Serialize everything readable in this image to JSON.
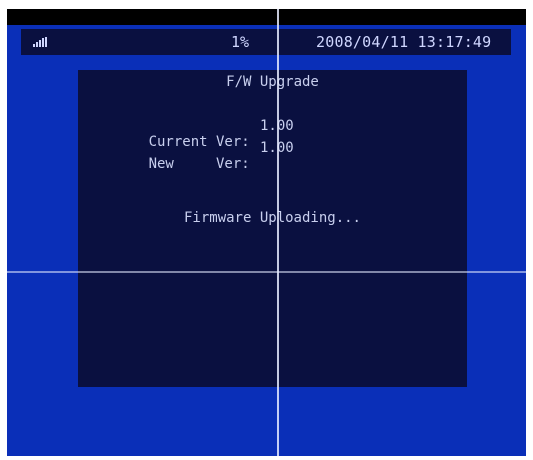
{
  "status_bar": {
    "icon": "signal-icon",
    "percent": "1%",
    "datetime": "2008/04/11 13:17:49"
  },
  "dialog": {
    "title": "F/W Upgrade",
    "current_label": "Current Ver:",
    "current_value": "1.00",
    "new_label": "New     Ver:",
    "new_value": "1.00",
    "status_message": "Firmware Uploading..."
  },
  "colors": {
    "background": "#0a2fb8",
    "panel": "#0a1040",
    "text": "#c8cfee"
  }
}
